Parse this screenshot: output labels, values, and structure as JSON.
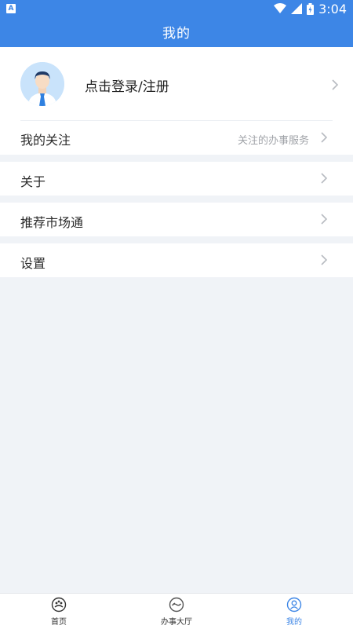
{
  "status_bar": {
    "time": "3:04",
    "app_icon": "A"
  },
  "header": {
    "title": "我的"
  },
  "profile": {
    "login_label": "点击登录/注册",
    "follow_label": "我的关注",
    "follow_sub": "关注的办事服务"
  },
  "menu": [
    {
      "label": "关于"
    },
    {
      "label": "推荐市场通"
    },
    {
      "label": "设置"
    }
  ],
  "tabs": [
    {
      "label": "首页",
      "icon": "home-icon"
    },
    {
      "label": "办事大厅",
      "icon": "service-hall-icon"
    },
    {
      "label": "我的",
      "icon": "profile-icon"
    }
  ],
  "colors": {
    "primary": "#3d86e6",
    "background": "#f0f3f7"
  }
}
